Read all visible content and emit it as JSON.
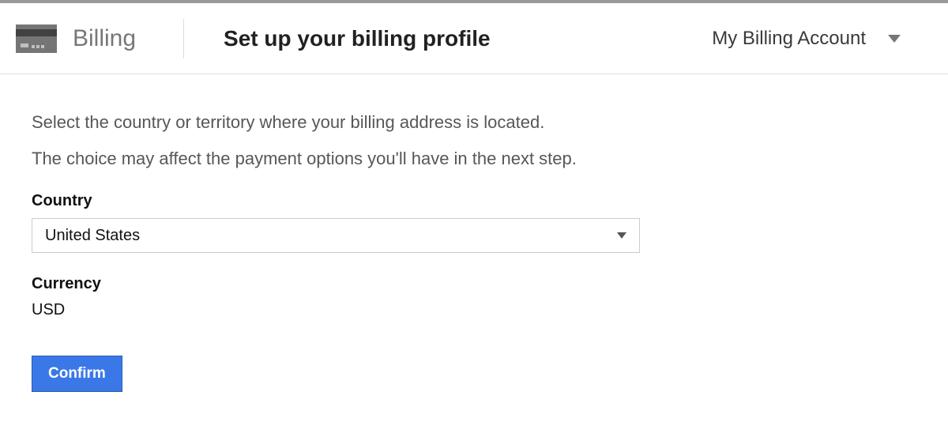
{
  "header": {
    "section_label": "Billing",
    "title": "Set up your billing profile",
    "account_name": "My Billing Account"
  },
  "form": {
    "instruction1": "Select the country or territory where your billing address is located.",
    "instruction2": "The choice may affect the payment options you'll have in the next step.",
    "country_label": "Country",
    "country_value": "United States",
    "currency_label": "Currency",
    "currency_value": "USD",
    "confirm_label": "Confirm"
  }
}
